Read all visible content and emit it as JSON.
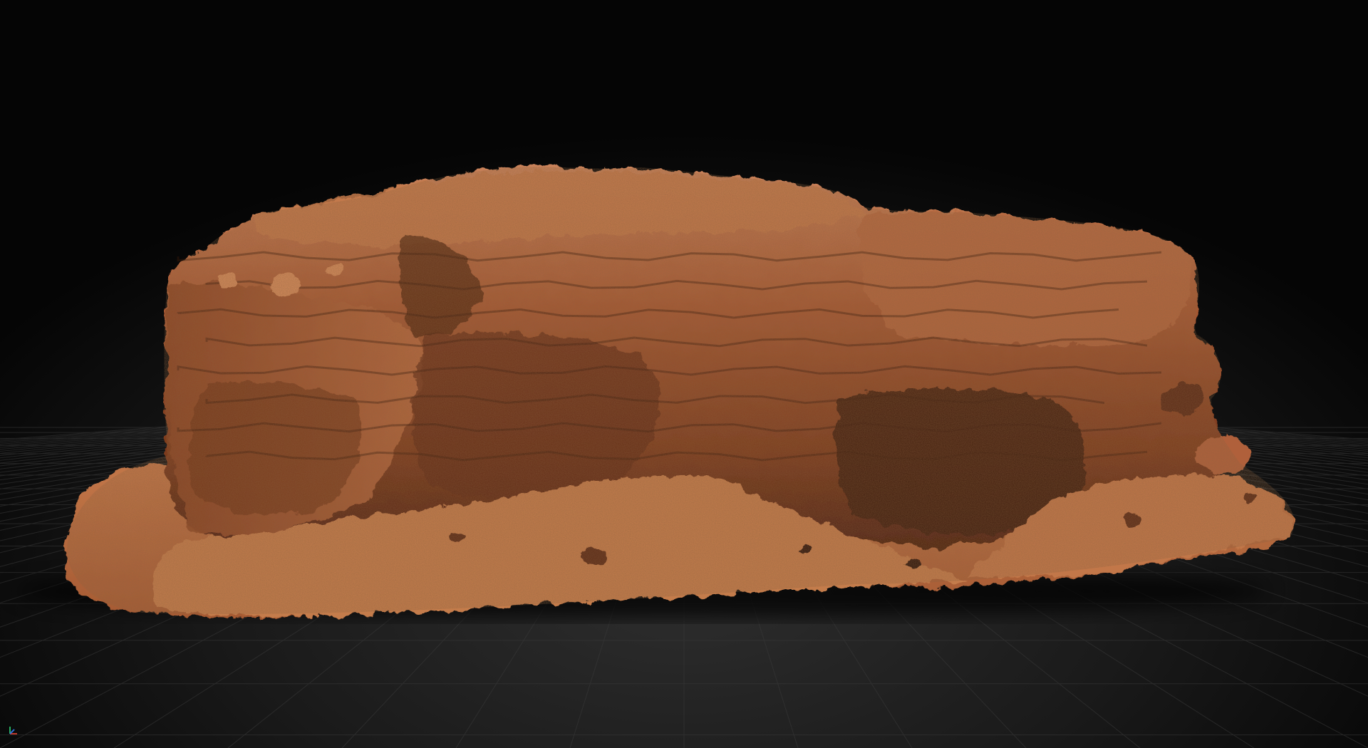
{
  "viewport": {
    "background_color": "#050505",
    "floor_color": "#1e1e1e",
    "grid_line_color": "#3a3a3a"
  },
  "subject": {
    "kind": "rock-formation-3d-model",
    "palette": {
      "highlight": "#d38a5a",
      "midtone": "#b0603a",
      "shadow": "#5a2a16",
      "deep_shadow": "#2e140a",
      "sand": "#c8794a"
    }
  },
  "gizmo": {
    "icon": "axis-gizmo-icon"
  }
}
